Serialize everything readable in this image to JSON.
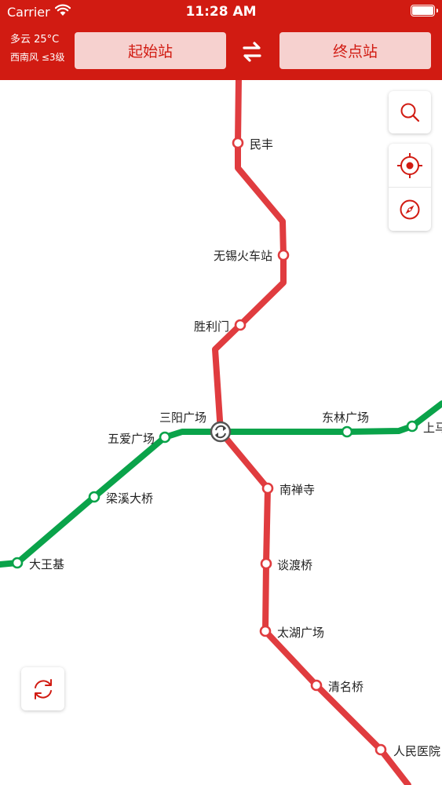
{
  "status_bar": {
    "carrier": "Carrier",
    "time": "11:28 AM"
  },
  "header": {
    "weather_condition": "多云 25°C",
    "weather_wind": "西南风 ≤3级",
    "start_station_label": "起始站",
    "end_station_label": "终点站"
  },
  "lines": [
    {
      "name": "red-line",
      "color": "#e03c3f",
      "stations": [
        "民丰",
        "无锡火车站",
        "胜利门",
        "三阳广场",
        "南禅寺",
        "谈渡桥",
        "太湖广场",
        "清名桥",
        "人民医院"
      ]
    },
    {
      "name": "green-line",
      "color": "#0aa34a",
      "stations": [
        "大王基",
        "梁溪大桥",
        "五爱广场",
        "三阳广场",
        "东林广场",
        "上马墩"
      ]
    }
  ],
  "map_labels": {
    "minfeng": "民丰",
    "wuxi_station": "无锡火车站",
    "shenglimen": "胜利门",
    "sanyang": "三阳广场",
    "wuai": "五爱广场",
    "donglin": "东林广场",
    "shangma": "上马",
    "liangxi": "梁溪大桥",
    "dawangji": "大王基",
    "nanchansi": "南禅寺",
    "tandu": "谈渡桥",
    "taihu": "太湖广场",
    "qingming": "清名桥",
    "renmin": "人民医院"
  },
  "colors": {
    "brand": "#d11b12",
    "red_line": "#e03c3f",
    "green_line": "#0aa34a"
  },
  "controls": [
    "search-icon",
    "locate-icon",
    "compass-icon",
    "refresh-icon"
  ]
}
